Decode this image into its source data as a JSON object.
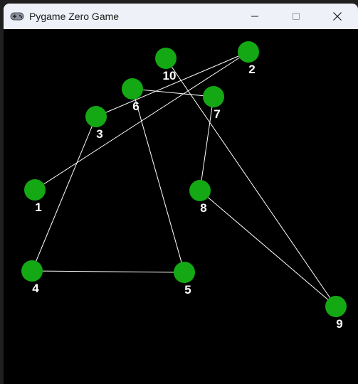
{
  "window": {
    "title": "Pygame Zero Game",
    "icon": "gamepad-icon",
    "controls": [
      "minimize-icon",
      "maximize-icon",
      "close-icon"
    ]
  },
  "game": {
    "background": "#000000",
    "dot_color": "#14a814",
    "line_color": "#ffffff",
    "label_color": "#ffffff",
    "dots": [
      {
        "label": "1"
      },
      {
        "label": "2"
      },
      {
        "label": "3"
      },
      {
        "label": "4"
      },
      {
        "label": "5"
      },
      {
        "label": "6"
      },
      {
        "label": "7"
      },
      {
        "label": "8"
      },
      {
        "label": "9"
      },
      {
        "label": "10"
      }
    ],
    "connections": [
      [
        1,
        2
      ],
      [
        2,
        3
      ],
      [
        3,
        4
      ],
      [
        4,
        5
      ],
      [
        5,
        6
      ],
      [
        6,
        7
      ],
      [
        7,
        8
      ],
      [
        8,
        9
      ],
      [
        9,
        10
      ]
    ]
  }
}
